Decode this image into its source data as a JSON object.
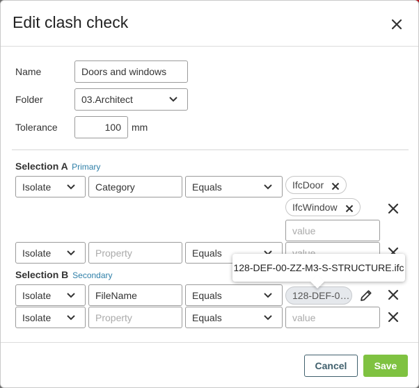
{
  "dialog": {
    "title": "Edit clash check",
    "close_icon": "close-icon"
  },
  "form": {
    "name_label": "Name",
    "name_value": "Doors and windows",
    "folder_label": "Folder",
    "folder_value": "03.Architect",
    "tolerance_label": "Tolerance",
    "tolerance_value": "100",
    "tolerance_unit": "mm"
  },
  "selection_a": {
    "title": "Selection A",
    "subtitle": "Primary",
    "rows": [
      {
        "mode": "Isolate",
        "property": "Category",
        "operator": "Equals",
        "values": [
          "IfcDoor",
          "IfcWindow"
        ],
        "value_placeholder": "value"
      },
      {
        "mode": "Isolate",
        "property_placeholder": "Property",
        "operator": "Equals",
        "value_placeholder": "value"
      }
    ]
  },
  "selection_b": {
    "title": "Selection B",
    "subtitle": "Secondary",
    "rows": [
      {
        "mode": "Isolate",
        "property": "FileName",
        "operator": "Equals",
        "value_chip": "128-DEF-0…",
        "tooltip": "128-DEF-00-ZZ-M3-S-STRUCTURE.ifc"
      },
      {
        "mode": "Isolate",
        "property_placeholder": "Property",
        "operator": "Equals",
        "value_placeholder": "value"
      }
    ]
  },
  "footer": {
    "cancel_label": "Cancel",
    "save_label": "Save"
  },
  "colors": {
    "primary_button": "#7fc241",
    "cancel_border": "#40606d",
    "subtitle_accent": "#2e7fa8"
  }
}
